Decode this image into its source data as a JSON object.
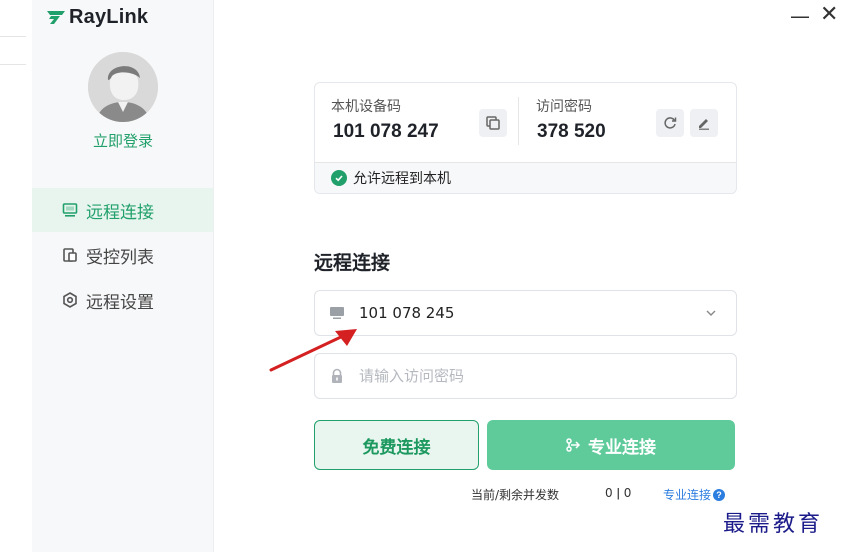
{
  "app": {
    "logo_text": "RayLink"
  },
  "window": {
    "minimize_glyph": "—",
    "close_glyph": "✕"
  },
  "sidebar": {
    "login_label": "立即登录",
    "items": [
      {
        "label": "远程连接",
        "icon": "monitor-icon",
        "active": true
      },
      {
        "label": "受控列表",
        "icon": "list-icon",
        "active": false
      },
      {
        "label": "远程设置",
        "icon": "settings-icon",
        "active": false
      }
    ]
  },
  "device": {
    "code_label": "本机设备码",
    "code_value": "101 078 247",
    "password_label": "访问密码",
    "password_value": "378 520",
    "allow_remote_label": "允许远程到本机"
  },
  "remote": {
    "title": "远程连接",
    "device_code_value": "101 078 245",
    "password_placeholder": "请输入访问密码",
    "free_connect_label": "免费连接",
    "pro_connect_label": "专业连接"
  },
  "footer": {
    "concurrency_label": "当前/剩余并发数",
    "concurrency_value": "0 ǀ 0",
    "pro_link_label": "专业连接"
  },
  "watermark": "最需教育",
  "colors": {
    "accent": "#22a06b",
    "pro_button": "#5fcb9b",
    "link": "#2b7de0",
    "arrow": "#d42020"
  }
}
